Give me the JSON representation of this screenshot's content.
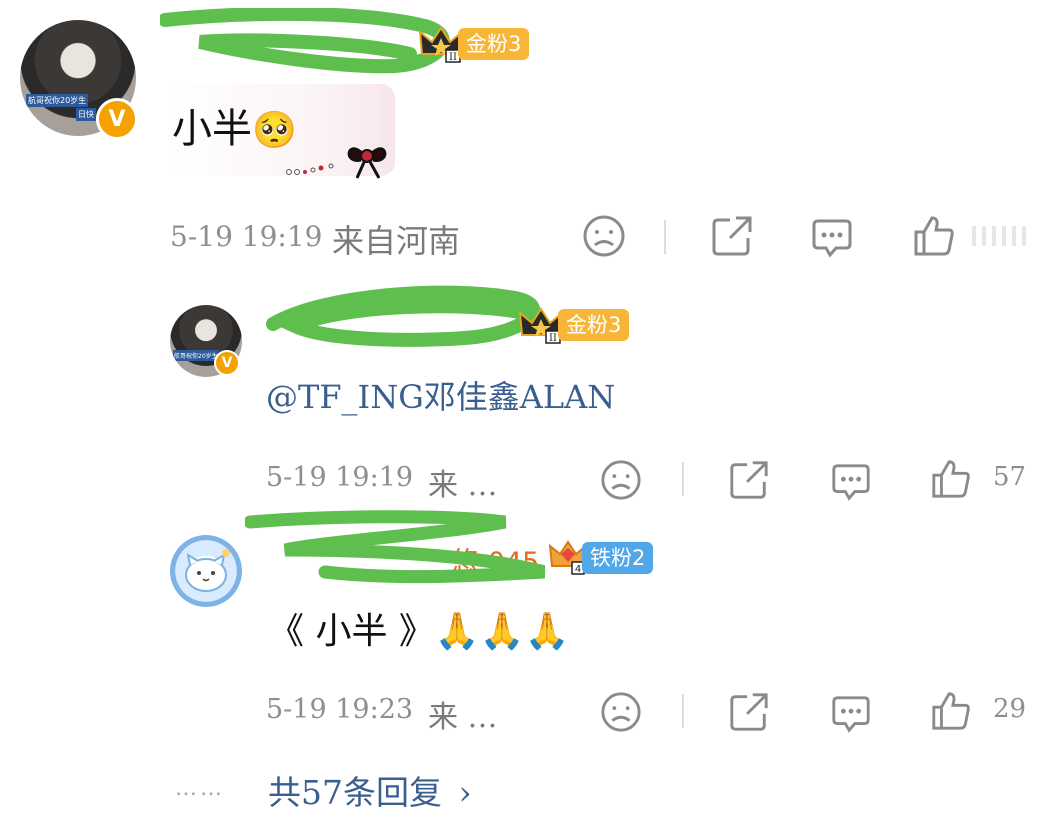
{
  "comment_main": {
    "fan_badge": "金粉3",
    "text": "小半",
    "time": "5-19 19:19",
    "location": "来自河南",
    "avatar_caption_line1": "航哥祝你20岁生",
    "avatar_caption_line2": "日快"
  },
  "reply_1": {
    "fan_badge": "金粉3",
    "mention": "@TF_ING邓佳鑫ALAN",
    "time": "5-19 19:19",
    "location_truncated": "来 …",
    "like_count": "57",
    "avatar_caption": "航哥祝你20岁生"
  },
  "reply_2": {
    "username_suffix": "悠-045",
    "fan_badge": "铁粉2",
    "text": "《 小半 》🙏🙏🙏",
    "time": "5-19 19:23",
    "location_truncated": "来 …",
    "like_count": "29"
  },
  "more_replies": {
    "dots": "……",
    "label": "共57条回复",
    "chevron": "›"
  },
  "icons": [
    "dislike-face-icon",
    "share-icon",
    "comment-icon",
    "like-thumb-icon",
    "chevron-right-icon",
    "crown-icon"
  ],
  "colors": {
    "username": "#e36a18",
    "gold_fan": "#f7b637",
    "iron_fan": "#52a7e8",
    "mention": "#3a5f8f",
    "meta": "#8f8f8f",
    "scribble": "#5fbf4e",
    "verified": "#f5a100"
  }
}
